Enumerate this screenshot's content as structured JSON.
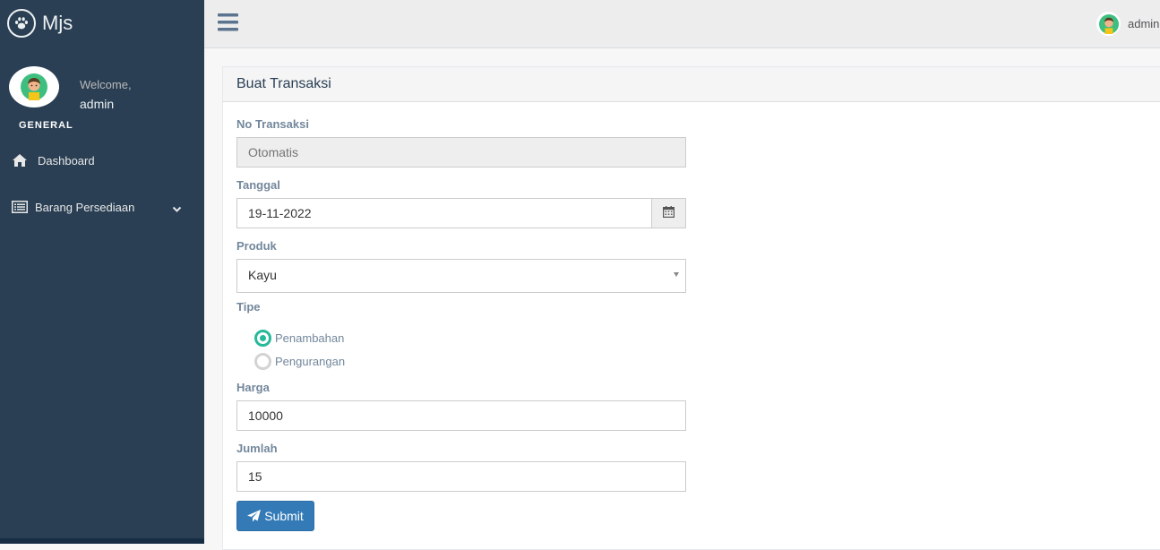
{
  "brand": {
    "title": "Mjs",
    "icon": "paw-icon"
  },
  "sidebar": {
    "welcome": "Welcome,",
    "username": "admin",
    "section_title": "GENERAL",
    "items": [
      {
        "label": "Dashboard",
        "icon": "home-icon"
      },
      {
        "label": "Barang Persediaan",
        "icon": "list-icon",
        "has_submenu": true
      }
    ]
  },
  "topnav": {
    "username": "admin",
    "menu_icon": "hamburger-icon"
  },
  "form": {
    "title": "Buat Transaksi",
    "no_transaksi": {
      "label": "No Transaksi",
      "placeholder": "Otomatis"
    },
    "tanggal": {
      "label": "Tanggal",
      "value": "19-11-2022"
    },
    "produk": {
      "label": "Produk",
      "selected": "Kayu"
    },
    "tipe": {
      "label": "Tipe",
      "options": [
        {
          "label": "Penambahan",
          "checked": true
        },
        {
          "label": "Pengurangan",
          "checked": false
        }
      ]
    },
    "harga": {
      "label": "Harga",
      "value": "10000"
    },
    "jumlah": {
      "label": "Jumlah",
      "value": "15"
    },
    "submit_label": "Submit"
  },
  "colors": {
    "sidebar_bg": "#2A3F54",
    "topnav_bg": "#EDEDED",
    "accent_green": "#26B99A",
    "primary_button": "#337AB7"
  }
}
